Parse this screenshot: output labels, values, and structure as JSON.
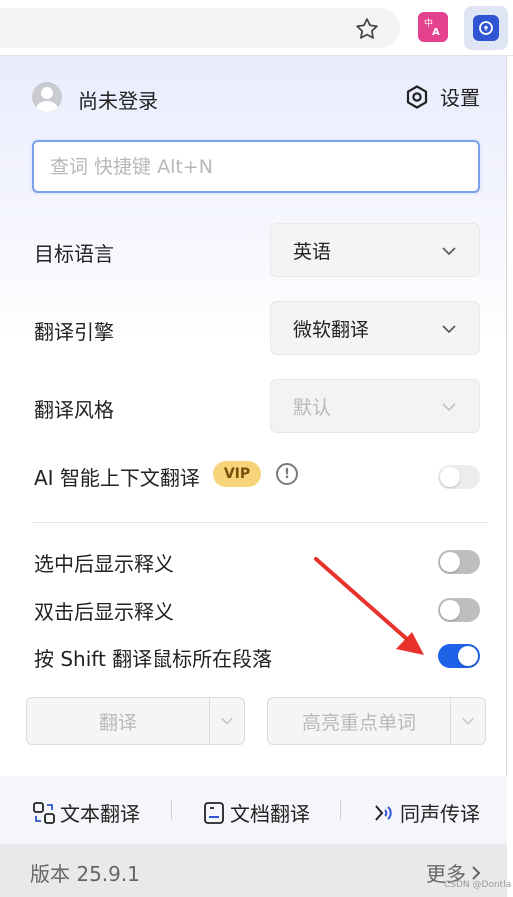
{
  "header": {
    "login_text": "尚未登录",
    "settings_label": "设置"
  },
  "search": {
    "placeholder": "查词 快捷键 Alt+N"
  },
  "settings": {
    "target_language": {
      "label": "目标语言",
      "value": "英语"
    },
    "engine": {
      "label": "翻译引擎",
      "value": "微软翻译"
    },
    "style": {
      "label": "翻译风格",
      "value": "默认"
    },
    "ai_context": {
      "label": "AI 智能上下文翻译",
      "badge": "VIP",
      "info": "!",
      "enabled": false
    }
  },
  "toggles": [
    {
      "label": "选中后显示释义",
      "enabled": false
    },
    {
      "label": "双击后显示释义",
      "enabled": false
    },
    {
      "label": "按 Shift 翻译鼠标所在段落",
      "enabled": true
    }
  ],
  "actions": {
    "translate_label": "翻译",
    "highlight_label": "高亮重点单词"
  },
  "tools": [
    {
      "label": "文本翻译",
      "icon": "text-translate-icon"
    },
    {
      "label": "文档翻译",
      "icon": "document-translate-icon"
    },
    {
      "label": "同声传译",
      "icon": "simultaneous-interpret-icon"
    }
  ],
  "footer": {
    "version": "版本 25.9.1",
    "more": "更多"
  },
  "watermark": "CSDN @Dontla",
  "colors": {
    "accent": "#1f62e8",
    "vip": "#f7d37a",
    "annotation_arrow": "#e8322b"
  }
}
